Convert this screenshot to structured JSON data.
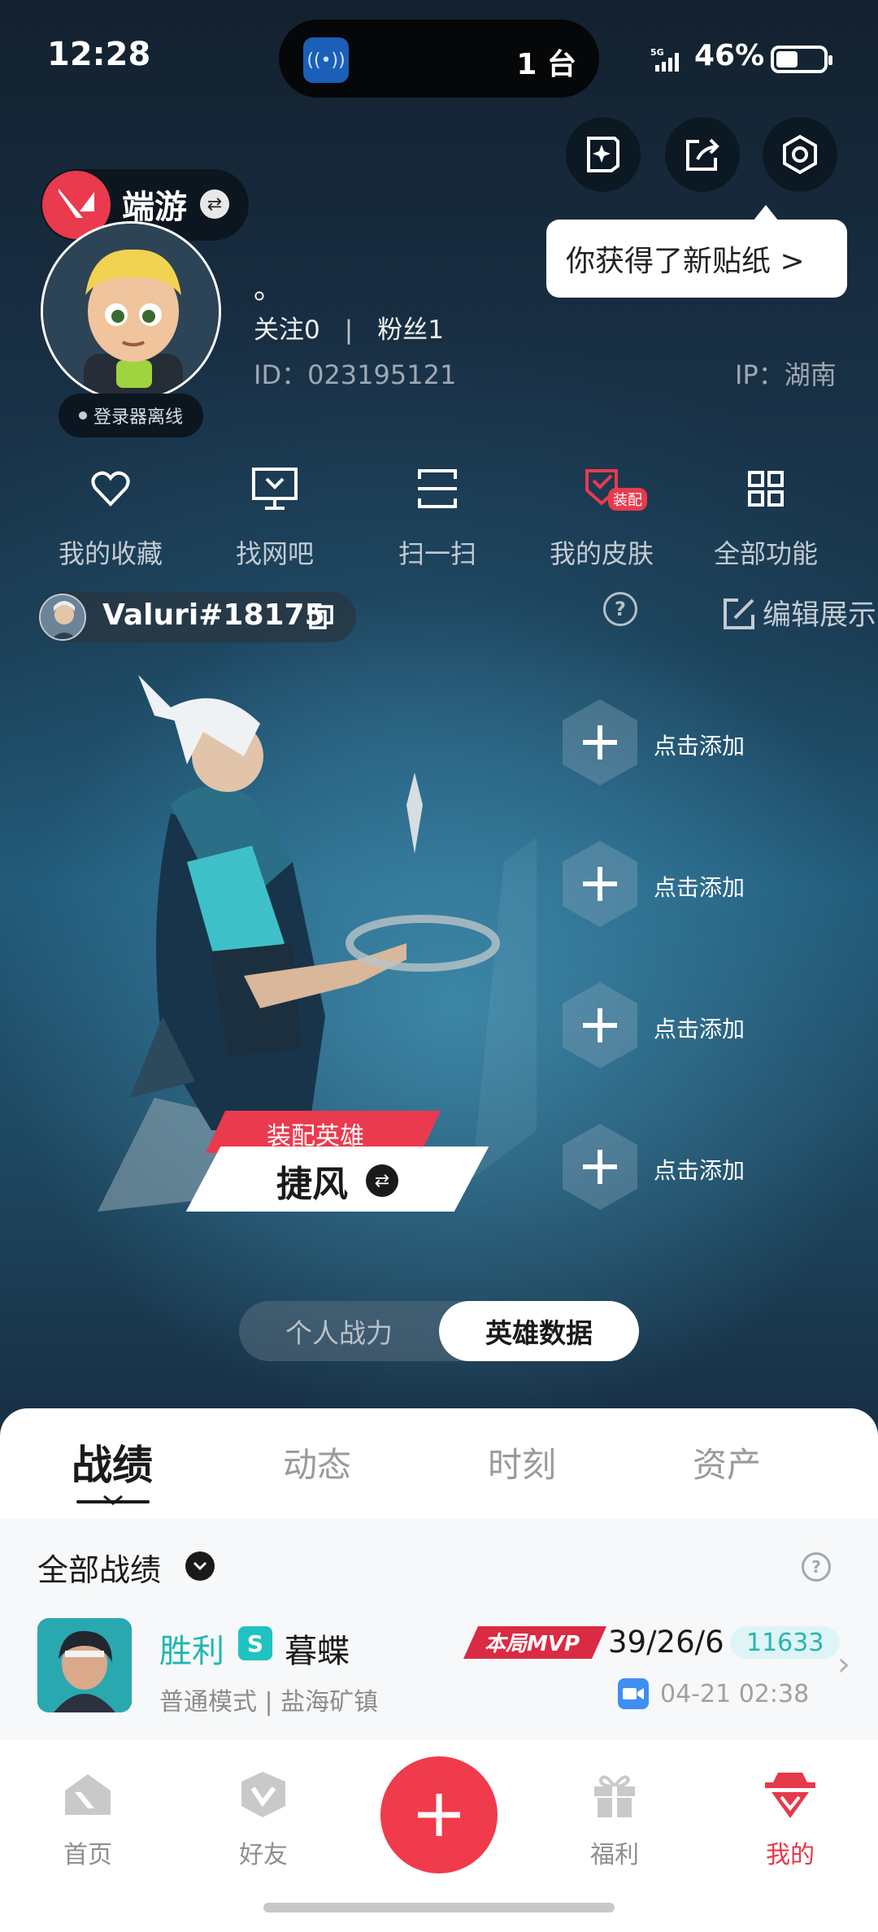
{
  "status_bar": {
    "time": "12:28",
    "island_count": "1 台",
    "island_app_glyph": "1",
    "network": "5G",
    "battery": "46%",
    "battery_level": 0.46
  },
  "profile": {
    "platform_name": "端游",
    "login_status": "登录器离线",
    "nickname": "。",
    "follow_label": "关注",
    "follow_count": "0",
    "fans_label": "粉丝",
    "fans_count": "1",
    "id_text": "ID：023195121",
    "ip_text": "IP：湖南",
    "sticker_tip": "你获得了新贴纸 >"
  },
  "functions": [
    {
      "label": "我的收藏",
      "icon": "heart-icon"
    },
    {
      "label": "找网吧",
      "icon": "monitor-icon"
    },
    {
      "label": "扫一扫",
      "icon": "scan-icon"
    },
    {
      "label": "我的皮肤",
      "icon": "skin-icon",
      "badge": "装配"
    },
    {
      "label": "全部功能",
      "icon": "grid-icon"
    }
  ],
  "riot": {
    "id": "Valuri#18175",
    "edit_label": "编辑展示"
  },
  "slots": [
    {
      "label": "点击添加"
    },
    {
      "label": "点击添加"
    },
    {
      "label": "点击添加"
    },
    {
      "label": "点击添加"
    }
  ],
  "hero": {
    "tag": "装配英雄",
    "name": "捷风"
  },
  "segment": {
    "left": "个人战力",
    "right": "英雄数据",
    "selected": "英雄数据"
  },
  "tabs": [
    "战绩",
    "动态",
    "时刻",
    "资产"
  ],
  "active_tab": "战绩",
  "filter": {
    "label": "全部战绩"
  },
  "match": {
    "result": "胜利",
    "rank_letter": "S",
    "agent": "暮蝶",
    "mvp_label": "本局MVP",
    "kda": "39/26/6",
    "score": "11633",
    "mode": "普通模式 | 盐海矿镇",
    "date": "04-21 02:38"
  },
  "bottom_nav": [
    {
      "label": "首页",
      "icon": "home-icon"
    },
    {
      "label": "好友",
      "icon": "friends-icon"
    },
    {
      "label": "福利",
      "icon": "gift-icon"
    },
    {
      "label": "我的",
      "icon": "profile-icon",
      "active": true
    }
  ],
  "colors": {
    "accent_red": "#ea3a4d",
    "win_teal": "#1fb7b4"
  }
}
